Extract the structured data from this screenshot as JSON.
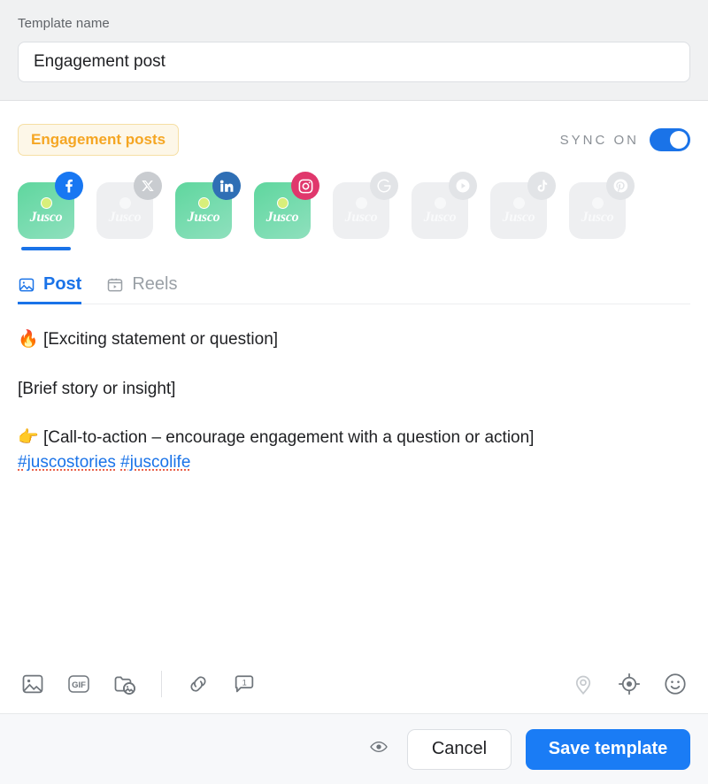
{
  "header": {
    "label": "Template name",
    "template_name_value": "Engagement post",
    "template_name_placeholder": "Template name"
  },
  "tag": {
    "label": "Engagement posts",
    "text_color": "#f5a623",
    "bg_color": "#fdf7e8"
  },
  "sync": {
    "label": "SYNC ON",
    "enabled": true,
    "accent_color": "#1a73e8"
  },
  "accounts": {
    "brand_label": "Jusco",
    "items": [
      {
        "network": "facebook",
        "icon": "facebook-icon",
        "enabled": true,
        "selected": true,
        "brand": "Jusco"
      },
      {
        "network": "x",
        "icon": "x-icon",
        "enabled": false,
        "selected": false,
        "brand": "Jusco"
      },
      {
        "network": "linkedin",
        "icon": "linkedin-icon",
        "enabled": true,
        "selected": false,
        "brand": "Jusco"
      },
      {
        "network": "instagram",
        "icon": "instagram-icon",
        "enabled": true,
        "selected": false,
        "brand": "Jusco"
      },
      {
        "network": "google",
        "icon": "google-icon",
        "enabled": false,
        "selected": false,
        "brand": "Jusco"
      },
      {
        "network": "youtube",
        "icon": "youtube-icon",
        "enabled": false,
        "selected": false,
        "brand": "Jusco"
      },
      {
        "network": "tiktok",
        "icon": "tiktok-icon",
        "enabled": false,
        "selected": false,
        "brand": "Jusco"
      },
      {
        "network": "pinterest",
        "icon": "pinterest-icon",
        "enabled": false,
        "selected": false,
        "brand": "Jusco"
      }
    ]
  },
  "tabs": [
    {
      "label": "Post",
      "icon": "image-icon",
      "active": true
    },
    {
      "label": "Reels",
      "icon": "reels-icon",
      "active": false
    }
  ],
  "editor": {
    "line1_emoji": "🔥",
    "line1": "[Exciting statement or question]",
    "line2": "[Brief story or insight]",
    "line3_emoji": "👉",
    "line3": "[Call-to-action – encourage engagement with a question or action]",
    "hashtag1": "#juscostories",
    "hashtag2": "#juscolife"
  },
  "toolbar": {
    "left": [
      {
        "name": "add-image-button",
        "icon": "image-icon"
      },
      {
        "name": "add-gif-button",
        "icon": "gif-icon",
        "label": "GIF"
      },
      {
        "name": "media-library-button",
        "icon": "media-folder-icon"
      }
    ],
    "left2": [
      {
        "name": "add-link-button",
        "icon": "link-icon"
      },
      {
        "name": "first-comment-button",
        "icon": "comment-icon",
        "badge": "1"
      }
    ],
    "right": [
      {
        "name": "location-button",
        "icon": "location-pin-icon",
        "faded": true
      },
      {
        "name": "target-audience-button",
        "icon": "target-icon",
        "faded": false
      },
      {
        "name": "emoji-button",
        "icon": "emoji-smiley-icon",
        "faded": false
      }
    ]
  },
  "footer": {
    "preview_icon": "eye-icon",
    "cancel_label": "Cancel",
    "save_label": "Save template",
    "save_color": "#1a7cf5"
  }
}
